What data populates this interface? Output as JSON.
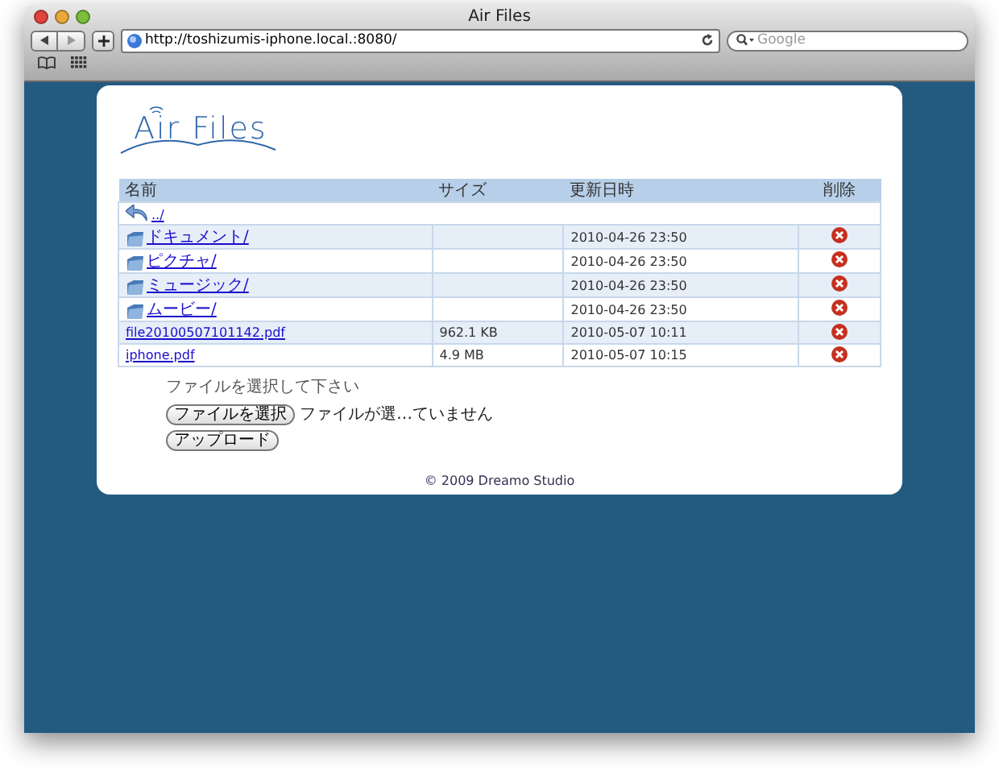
{
  "window": {
    "title": "Air Files"
  },
  "toolbar": {
    "url": "http://toshizumis-iphone.local.:8080/",
    "search_placeholder": "Google"
  },
  "logo": {
    "text": "Air Files"
  },
  "table": {
    "columns": [
      "名前",
      "サイズ",
      "更新日時",
      "削除"
    ],
    "rows": [
      {
        "kind": "parent",
        "name": "../"
      },
      {
        "kind": "folder",
        "name": "ドキュメント/",
        "size": "",
        "date": "2010-04-26 23:50"
      },
      {
        "kind": "folder",
        "name": "ピクチャ/",
        "size": "",
        "date": "2010-04-26 23:50"
      },
      {
        "kind": "folder",
        "name": "ミュージック/",
        "size": "",
        "date": "2010-04-26 23:50"
      },
      {
        "kind": "folder",
        "name": "ムービー/",
        "size": "",
        "date": "2010-04-26 23:50"
      },
      {
        "kind": "file",
        "name": "file20100507101142.pdf",
        "size": "962.1 KB",
        "date": "2010-05-07 10:11"
      },
      {
        "kind": "file",
        "name": "iphone.pdf",
        "size": "4.9 MB",
        "date": "2010-05-07 10:15"
      }
    ]
  },
  "upload": {
    "prompt": "ファイルを選択して下さい",
    "choose_button": "ファイルを選択",
    "no_file": "ファイルが選…ていません",
    "upload_button": "アップロード"
  },
  "footer": "© 2009 Dreamo Studio"
}
